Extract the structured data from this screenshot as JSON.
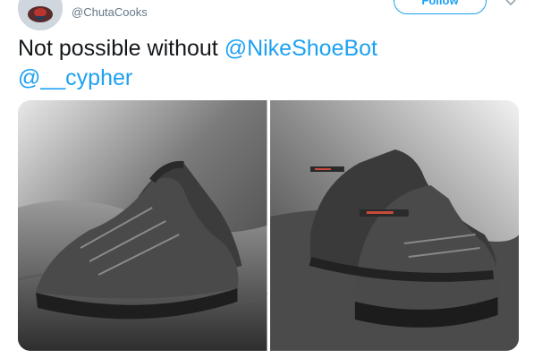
{
  "user": {
    "handle": "@ChutaCooks"
  },
  "actions": {
    "follow_label": "Follow"
  },
  "tweet": {
    "text_plain": "Not possible without ",
    "mention_1": "@NikeShoeBot",
    "mention_2": "@__cypher"
  },
  "icons": {
    "avatar": "avatar-image",
    "menu": "chevron-down-icon"
  },
  "colors": {
    "accent": "#1da1f2",
    "text_primary": "#14171a",
    "text_secondary": "#657786"
  },
  "media": {
    "photos": [
      {
        "description_name": "sneaker-photo-front"
      },
      {
        "description_name": "sneaker-photo-back"
      }
    ]
  }
}
